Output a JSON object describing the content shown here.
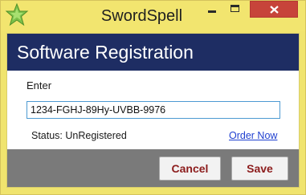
{
  "window": {
    "title": "SwordSpell",
    "icon": "app-star-icon",
    "controls": {
      "minimize_icon": "minimize-icon",
      "maximize_icon": "maximize-icon",
      "close_icon": "close-icon"
    }
  },
  "dialog": {
    "heading": "Software Registration",
    "enter_label": "Enter",
    "key_value": "1234-FGHJ-89Hy-UVBB-9976",
    "status_text": "Status: UnRegistered",
    "order_link": "Order Now"
  },
  "buttons": {
    "cancel": "Cancel",
    "save": "Save"
  },
  "colors": {
    "titlebar": "#f2e56f",
    "header": "#1e2d63",
    "close_button": "#c7443a",
    "footer": "#7a7a7a",
    "button_text": "#8c1c1c",
    "link": "#1f3fd0",
    "input_border": "#4d9ad2"
  }
}
